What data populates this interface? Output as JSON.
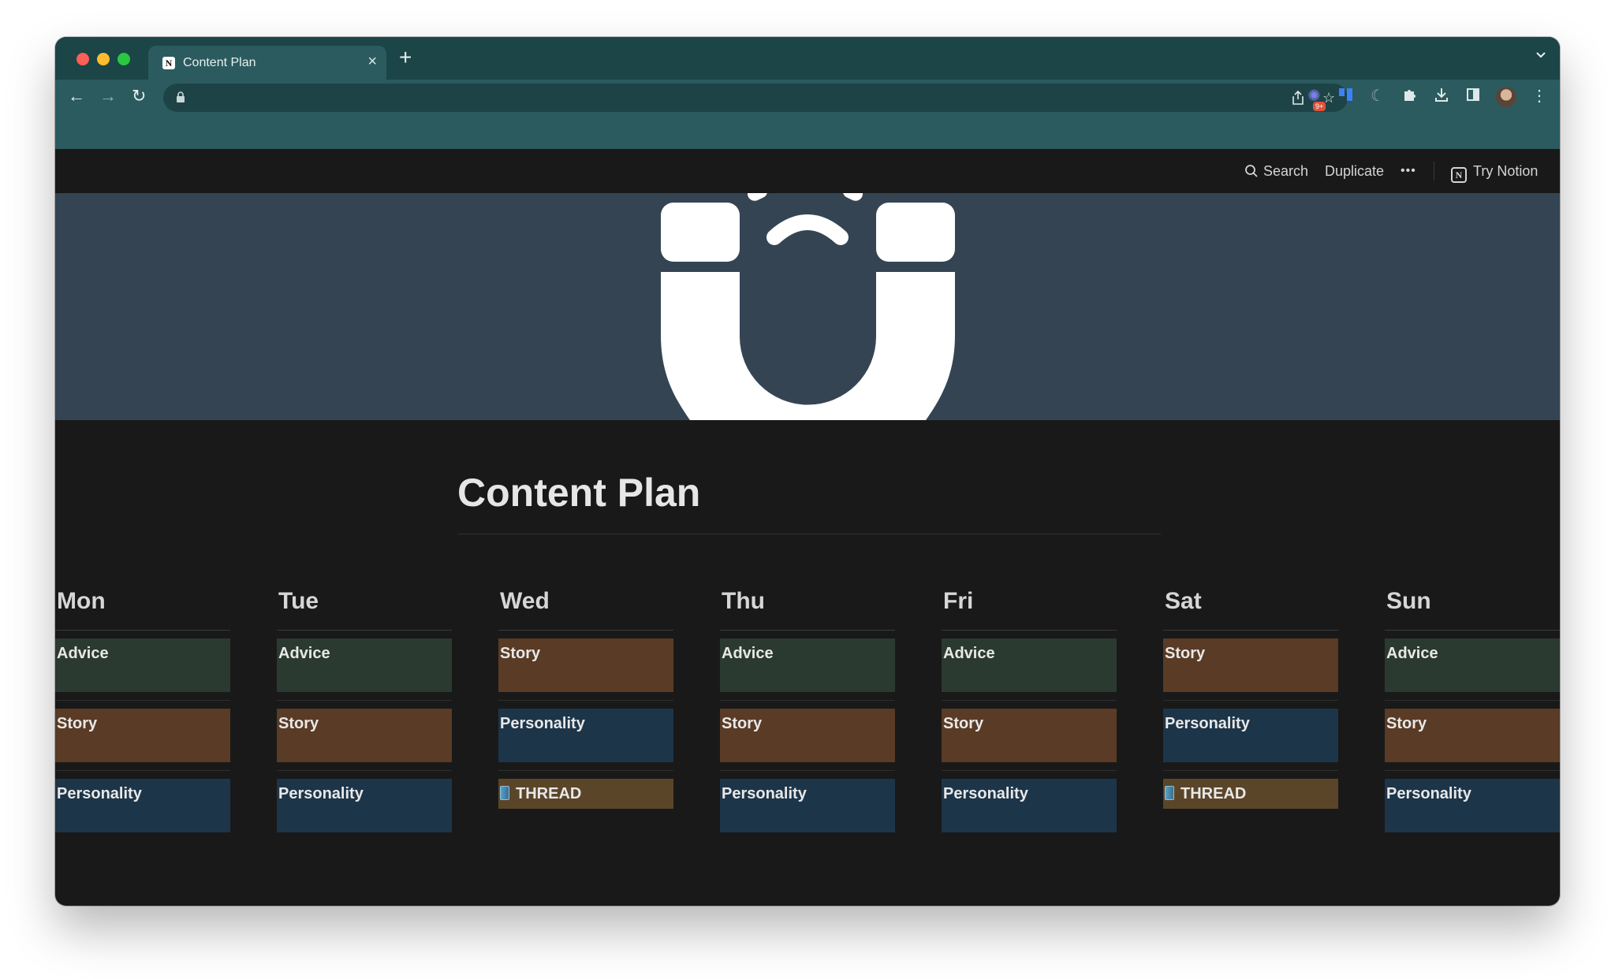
{
  "browser": {
    "tab_title": "Content Plan",
    "tab_close": "×",
    "new_tab": "+",
    "tab_menu": "⌄",
    "extension_badge": "9+"
  },
  "notion_topbar": {
    "search_label": "Search",
    "duplicate_label": "Duplicate",
    "more_label": "•••",
    "try_label": "Try Notion"
  },
  "page": {
    "title": "Content Plan"
  },
  "colors": {
    "advice": "#2b3a30",
    "story": "#5a3b25",
    "personality": "#1d3549",
    "thread": "#5b4528"
  },
  "days": [
    {
      "name": "Mon",
      "cards": [
        {
          "label": "Advice",
          "type": "advice"
        },
        {
          "label": "Story",
          "type": "story"
        },
        {
          "label": "Personality",
          "type": "personality"
        }
      ]
    },
    {
      "name": "Tue",
      "cards": [
        {
          "label": "Advice",
          "type": "advice"
        },
        {
          "label": "Story",
          "type": "story"
        },
        {
          "label": "Personality",
          "type": "personality"
        }
      ]
    },
    {
      "name": "Wed",
      "cards": [
        {
          "label": "Story",
          "type": "story"
        },
        {
          "label": "Personality",
          "type": "personality"
        },
        {
          "label": "THREAD",
          "type": "thread"
        }
      ]
    },
    {
      "name": "Thu",
      "cards": [
        {
          "label": "Advice",
          "type": "advice"
        },
        {
          "label": "Story",
          "type": "story"
        },
        {
          "label": "Personality",
          "type": "personality"
        }
      ]
    },
    {
      "name": "Fri",
      "cards": [
        {
          "label": "Advice",
          "type": "advice"
        },
        {
          "label": "Story",
          "type": "story"
        },
        {
          "label": "Personality",
          "type": "personality"
        }
      ]
    },
    {
      "name": "Sat",
      "cards": [
        {
          "label": "Story",
          "type": "story"
        },
        {
          "label": "Personality",
          "type": "personality"
        },
        {
          "label": "THREAD",
          "type": "thread"
        }
      ]
    },
    {
      "name": "Sun",
      "cards": [
        {
          "label": "Advice",
          "type": "advice"
        },
        {
          "label": "Story",
          "type": "story"
        },
        {
          "label": "Personality",
          "type": "personality"
        }
      ]
    }
  ]
}
